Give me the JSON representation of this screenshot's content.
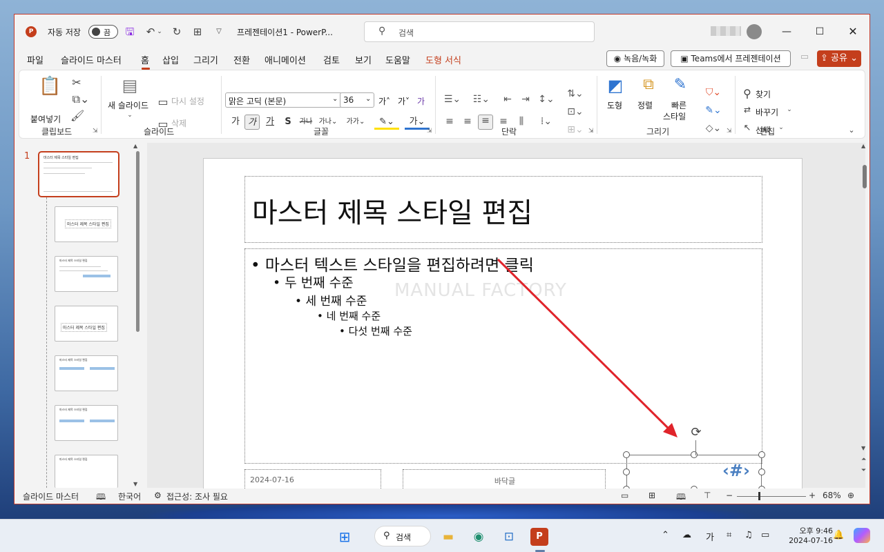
{
  "titlebar": {
    "autosave_label": "자동 저장",
    "autosave_state": "끔",
    "doc_title": "프레젠테이션1  -  PowerP...",
    "search_placeholder": "검색",
    "minimize": "—",
    "maximize": "☐",
    "close": "✕"
  },
  "tabs": [
    "파일",
    "슬라이드 마스터",
    "홈",
    "삽입",
    "그리기",
    "전환",
    "애니메이션",
    "검토",
    "보기",
    "도움말",
    "도형 서식"
  ],
  "active_tab": "홈",
  "context_tab_color": "#c43e1c",
  "tab_buttons": {
    "record": "녹음/녹화",
    "teams": "Teams에서 프레젠테이션",
    "share": "공유"
  },
  "ribbon": {
    "clipboard": {
      "label": "클립보드",
      "paste": "붙여넣기"
    },
    "slides": {
      "label": "슬라이드",
      "new_slide": "새 슬라이드",
      "reset": "다시 설정",
      "delete": "삭제"
    },
    "font": {
      "label": "글꼴",
      "font_name": "맑은 고딕 (본문)",
      "font_size": "36",
      "grow": "가˄",
      "shrink": "가˅",
      "clear": "가"
    },
    "paragraph": {
      "label": "단락"
    },
    "drawing": {
      "label": "그리기",
      "shapes": "도형",
      "arrange": "정렬",
      "quick_styles_1": "빠른",
      "quick_styles_2": "스타일"
    },
    "editing": {
      "label": "편집",
      "find": "찾기",
      "replace": "바꾸기",
      "select": "선택"
    }
  },
  "thumbnails": {
    "first_number": "1",
    "first_caption": "마스터 제목 스타일 편집",
    "layout_caption": "마스터 제목 스타일 편집"
  },
  "slide": {
    "title": "마스터 제목 스타일 편집",
    "bullets": [
      "마스터 텍스트 스타일을 편집하려면 클릭",
      "두 번째 수준",
      "세 번째 수준",
      "네 번째 수준",
      "다섯 번째 수준"
    ],
    "watermark": "MANUAL FACTORY",
    "date": "2024-07-16",
    "footer": "바닥글",
    "slide_number": "‹#›"
  },
  "annotation_arrow_color": "#e0242b",
  "statusbar": {
    "view_name": "슬라이드 마스터",
    "language": "한국어",
    "accessibility": "접근성: 조사 필요",
    "zoom": "68%",
    "zoom_percent": 68
  },
  "taskbar": {
    "search": "검색",
    "ime": "가",
    "time": "오후 9:46",
    "date": "2024-07-16"
  }
}
